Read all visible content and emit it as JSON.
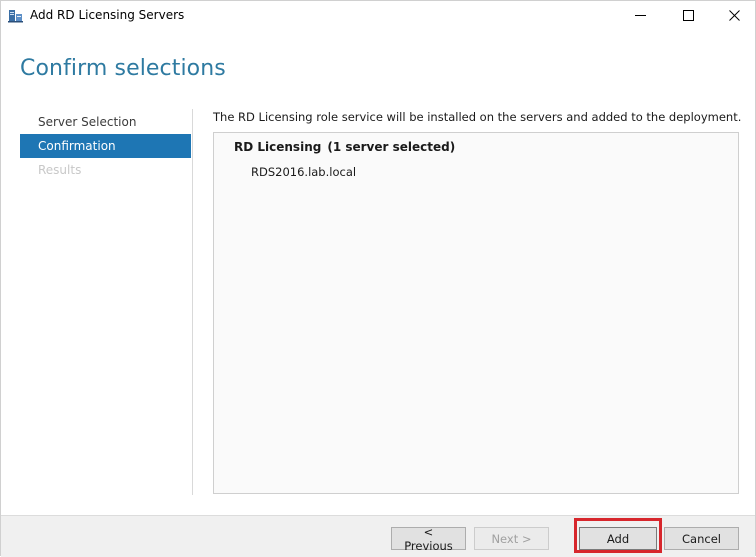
{
  "window": {
    "title": "Add RD Licensing Servers",
    "icon": "server-manager-icon"
  },
  "header": {
    "title": "Confirm selections"
  },
  "nav": {
    "items": [
      {
        "label": "Server Selection",
        "state": "normal"
      },
      {
        "label": "Confirmation",
        "state": "active"
      },
      {
        "label": "Results",
        "state": "disabled"
      }
    ]
  },
  "content": {
    "intro": "The RD Licensing role service will be installed on the servers and added to the deployment.",
    "role_name": "RD Licensing",
    "role_count": "(1 server selected)",
    "servers": [
      "RDS2016.lab.local"
    ]
  },
  "footer": {
    "previous_label": "< Previous",
    "next_label": "Next >",
    "add_label": "Add",
    "cancel_label": "Cancel"
  },
  "colors": {
    "accent": "#1e76b4",
    "title": "#2e7aa1",
    "highlight": "#d7262c"
  }
}
